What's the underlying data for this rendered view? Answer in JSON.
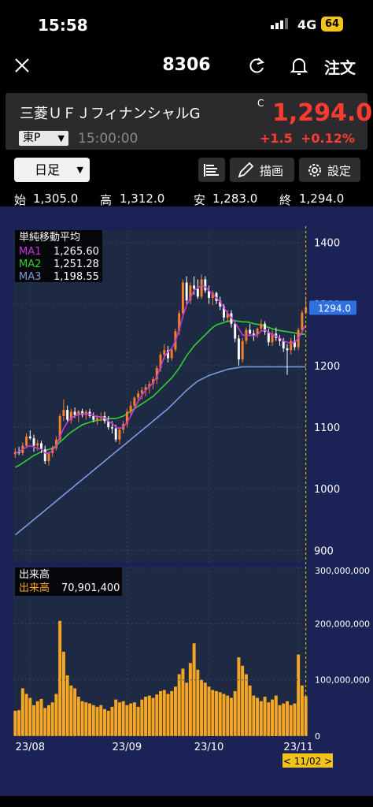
{
  "status": {
    "time": "15:58",
    "network": "4G",
    "battery": "64"
  },
  "nav": {
    "title": "8306",
    "order_label": "注文",
    "close_icon": "close-icon",
    "refresh_icon": "refresh-icon",
    "bell_icon": "bell-icon"
  },
  "quote": {
    "name": "三菱ＵＦＪフィナンシャルG",
    "close_mark": "C",
    "price": "1,294.0",
    "market": "東P",
    "time": "15:00:00",
    "change": "+1.5",
    "change_pct": "+0.12%"
  },
  "toolbar": {
    "period": "日足",
    "draw_label": "描画",
    "settings_label": "設定"
  },
  "ohlc": {
    "open_label": "始",
    "open": "1,305.0",
    "high_label": "高",
    "high": "1,312.0",
    "low_label": "安",
    "low": "1,283.0",
    "close_label": "終",
    "close": "1,294.0"
  },
  "colors": {
    "up": "#f5822a",
    "down": "#ffffff",
    "ma1": "#c838d8",
    "ma2": "#2ed12e",
    "ma3": "#7b9ae0",
    "volume": "#f5a623",
    "panel": "#1e2a44",
    "bg": "#1b2255"
  },
  "chart_data": [
    {
      "type": "candlestick",
      "title": "単純移動平均",
      "legend": [
        {
          "name": "MA1",
          "value": "1,265.60"
        },
        {
          "name": "MA2",
          "value": "1,251.28"
        },
        {
          "name": "MA3",
          "value": "1,198.55"
        }
      ],
      "y_ticks": [
        "1400",
        "1300",
        "1200",
        "1100",
        "1000",
        "900"
      ],
      "ylim": [
        880,
        1420
      ],
      "last_price_label": "1294.0",
      "x_ticks": [
        "23/08",
        "23/09",
        "23/10",
        "23/11"
      ],
      "candles": [
        [
          1056,
          1066,
          1050,
          1060
        ],
        [
          1060,
          1068,
          1055,
          1058
        ],
        [
          1058,
          1075,
          1054,
          1070
        ],
        [
          1070,
          1090,
          1066,
          1085
        ],
        [
          1085,
          1095,
          1080,
          1082
        ],
        [
          1082,
          1088,
          1060,
          1070
        ],
        [
          1070,
          1080,
          1062,
          1074
        ],
        [
          1074,
          1078,
          1058,
          1064
        ],
        [
          1064,
          1070,
          1040,
          1045
        ],
        [
          1045,
          1060,
          1038,
          1058
        ],
        [
          1058,
          1070,
          1052,
          1066
        ],
        [
          1066,
          1085,
          1062,
          1080
        ],
        [
          1080,
          1122,
          1076,
          1118
        ],
        [
          1118,
          1145,
          1110,
          1128
        ],
        [
          1128,
          1135,
          1108,
          1112
        ],
        [
          1112,
          1130,
          1106,
          1125
        ],
        [
          1125,
          1132,
          1115,
          1120
        ],
        [
          1120,
          1128,
          1108,
          1126
        ],
        [
          1126,
          1130,
          1116,
          1120
        ],
        [
          1120,
          1128,
          1112,
          1125
        ],
        [
          1125,
          1130,
          1115,
          1118
        ],
        [
          1118,
          1124,
          1108,
          1112
        ],
        [
          1112,
          1120,
          1104,
          1115
        ],
        [
          1115,
          1124,
          1110,
          1118
        ],
        [
          1118,
          1125,
          1106,
          1110
        ],
        [
          1110,
          1118,
          1096,
          1100
        ],
        [
          1100,
          1110,
          1090,
          1098
        ],
        [
          1098,
          1104,
          1076,
          1080
        ],
        [
          1080,
          1100,
          1072,
          1096
        ],
        [
          1096,
          1110,
          1090,
          1105
        ],
        [
          1105,
          1130,
          1100,
          1125
        ],
        [
          1125,
          1142,
          1118,
          1135
        ],
        [
          1135,
          1150,
          1130,
          1148
        ],
        [
          1148,
          1160,
          1140,
          1155
        ],
        [
          1155,
          1165,
          1145,
          1160
        ],
        [
          1160,
          1170,
          1150,
          1165
        ],
        [
          1165,
          1175,
          1155,
          1170
        ],
        [
          1170,
          1182,
          1162,
          1178
        ],
        [
          1178,
          1200,
          1170,
          1196
        ],
        [
          1196,
          1222,
          1190,
          1218
        ],
        [
          1218,
          1235,
          1210,
          1225
        ],
        [
          1225,
          1232,
          1205,
          1212
        ],
        [
          1212,
          1230,
          1208,
          1226
        ],
        [
          1226,
          1260,
          1222,
          1256
        ],
        [
          1256,
          1290,
          1250,
          1285
        ],
        [
          1285,
          1340,
          1280,
          1335
        ],
        [
          1335,
          1345,
          1300,
          1306
        ],
        [
          1306,
          1335,
          1300,
          1330
        ],
        [
          1330,
          1345,
          1315,
          1325
        ],
        [
          1325,
          1340,
          1308,
          1312
        ],
        [
          1312,
          1348,
          1308,
          1340
        ],
        [
          1340,
          1345,
          1318,
          1322
        ],
        [
          1322,
          1330,
          1300,
          1310
        ],
        [
          1310,
          1322,
          1298,
          1318
        ],
        [
          1318,
          1320,
          1300,
          1305
        ],
        [
          1305,
          1312,
          1290,
          1296
        ],
        [
          1296,
          1300,
          1272,
          1278
        ],
        [
          1278,
          1290,
          1270,
          1285
        ],
        [
          1285,
          1290,
          1262,
          1268
        ],
        [
          1268,
          1272,
          1238,
          1244
        ],
        [
          1244,
          1250,
          1200,
          1210
        ],
        [
          1210,
          1245,
          1205,
          1240
        ],
        [
          1240,
          1262,
          1235,
          1258
        ],
        [
          1258,
          1268,
          1248,
          1252
        ],
        [
          1252,
          1258,
          1240,
          1250
        ],
        [
          1250,
          1262,
          1245,
          1260
        ],
        [
          1260,
          1275,
          1255,
          1268
        ],
        [
          1268,
          1272,
          1250,
          1255
        ],
        [
          1255,
          1260,
          1232,
          1238
        ],
        [
          1238,
          1258,
          1232,
          1252
        ],
        [
          1252,
          1262,
          1240,
          1245
        ],
        [
          1245,
          1250,
          1232,
          1240
        ],
        [
          1240,
          1245,
          1222,
          1228
        ],
        [
          1228,
          1235,
          1185,
          1225
        ],
        [
          1225,
          1245,
          1218,
          1240
        ],
        [
          1240,
          1250,
          1225,
          1230
        ],
        [
          1230,
          1262,
          1225,
          1258
        ],
        [
          1258,
          1290,
          1250,
          1286
        ],
        [
          1286,
          1312,
          1283,
          1294
        ]
      ],
      "ma1": [
        1058,
        1060,
        1064,
        1068,
        1070,
        1068,
        1066,
        1064,
        1058,
        1058,
        1062,
        1070,
        1085,
        1098,
        1108,
        1115,
        1118,
        1120,
        1122,
        1122,
        1121,
        1119,
        1117,
        1117,
        1115,
        1110,
        1106,
        1100,
        1098,
        1100,
        1108,
        1118,
        1130,
        1142,
        1152,
        1160,
        1166,
        1172,
        1182,
        1198,
        1214,
        1222,
        1228,
        1240,
        1258,
        1280,
        1298,
        1310,
        1322,
        1326,
        1330,
        1328,
        1322,
        1316,
        1310,
        1304,
        1294,
        1285,
        1278,
        1270,
        1260,
        1250,
        1248,
        1250,
        1248,
        1250,
        1256,
        1258,
        1254,
        1250,
        1248,
        1245,
        1240,
        1238,
        1236,
        1238,
        1244,
        1255,
        1266
      ],
      "ma2": [
        1035,
        1038,
        1042,
        1046,
        1050,
        1054,
        1057,
        1060,
        1062,
        1064,
        1066,
        1070,
        1076,
        1081,
        1087,
        1092,
        1096,
        1100,
        1104,
        1106,
        1108,
        1110,
        1111,
        1112,
        1113,
        1114,
        1114,
        1114,
        1116,
        1118,
        1122,
        1126,
        1130,
        1134,
        1138,
        1142,
        1146,
        1150,
        1156,
        1162,
        1168,
        1174,
        1180,
        1188,
        1196,
        1206,
        1216,
        1224,
        1232,
        1238,
        1244,
        1250,
        1256,
        1262,
        1266,
        1268,
        1270,
        1272,
        1273,
        1273,
        1272,
        1271,
        1271,
        1270,
        1268,
        1267,
        1266,
        1264,
        1262,
        1260,
        1258,
        1257,
        1256,
        1255,
        1254,
        1253,
        1252,
        1251,
        1251
      ],
      "ma3": [
        925,
        930,
        935,
        940,
        945,
        950,
        955,
        960,
        965,
        970,
        975,
        980,
        985,
        990,
        995,
        1000,
        1005,
        1010,
        1015,
        1020,
        1025,
        1030,
        1035,
        1040,
        1045,
        1050,
        1055,
        1060,
        1065,
        1070,
        1075,
        1080,
        1085,
        1090,
        1095,
        1100,
        1105,
        1110,
        1115,
        1120,
        1125,
        1130,
        1136,
        1142,
        1148,
        1154,
        1160,
        1165,
        1170,
        1175,
        1178,
        1181,
        1184,
        1186,
        1188,
        1190,
        1192,
        1194,
        1195,
        1196,
        1197,
        1198,
        1198,
        1198,
        1198,
        1198,
        1198,
        1198,
        1198,
        1198,
        1198,
        1198,
        1198,
        1198,
        1198,
        1198,
        1198,
        1198,
        1198
      ]
    },
    {
      "type": "bar",
      "title": "出来高",
      "legend": [
        {
          "name": "出来高",
          "value": "70,901,400"
        }
      ],
      "y_ticks": [
        "300,000,000",
        "200,000,000",
        "100,000,000",
        "0"
      ],
      "ylim": [
        0,
        300000000
      ],
      "cursor_date": "< 11/02 >",
      "values": [
        45,
        46,
        85,
        75,
        68,
        55,
        62,
        66,
        50,
        55,
        60,
        75,
        205,
        150,
        108,
        90,
        85,
        70,
        62,
        60,
        58,
        55,
        52,
        55,
        48,
        45,
        52,
        65,
        60,
        62,
        55,
        58,
        60,
        52,
        65,
        70,
        72,
        68,
        74,
        80,
        82,
        75,
        80,
        88,
        110,
        120,
        95,
        130,
        165,
        118,
        100,
        95,
        88,
        82,
        80,
        78,
        75,
        72,
        68,
        80,
        140,
        125,
        110,
        90,
        72,
        68,
        62,
        70,
        60,
        65,
        72,
        55,
        58,
        62,
        55,
        58,
        145,
        90,
        71
      ]
    }
  ]
}
